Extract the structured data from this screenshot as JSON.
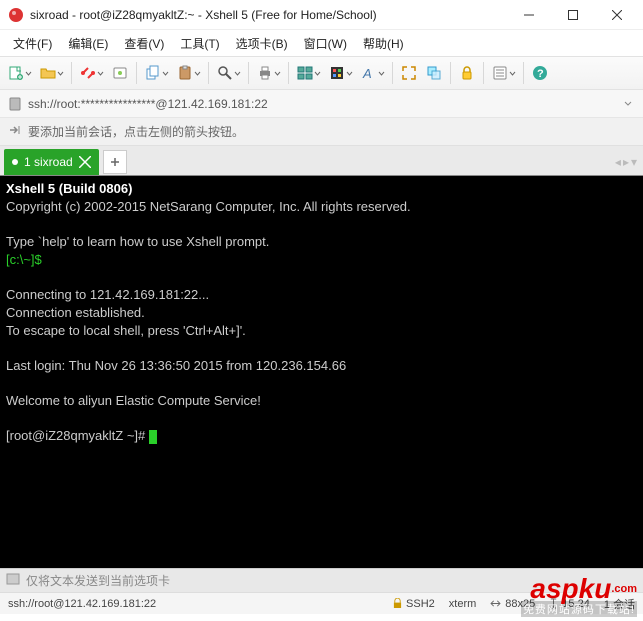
{
  "titlebar": {
    "title": "sixroad - root@iZ28qmyakltZ:~ - Xshell 5 (Free for Home/School)"
  },
  "menu": {
    "file": "文件(F)",
    "edit": "编辑(E)",
    "view": "查看(V)",
    "tools": "工具(T)",
    "tabs": "选项卡(B)",
    "window": "窗口(W)",
    "help": "帮助(H)"
  },
  "addressbar": {
    "text": "ssh://root:****************@121.42.169.181:22"
  },
  "hintbar": {
    "text": "要添加当前会话，点击左侧的箭头按钮。"
  },
  "tab": {
    "label": "1 sixroad"
  },
  "terminal": {
    "l1": "Xshell 5 (Build 0806)",
    "l2": "Copyright (c) 2002-2015 NetSarang Computer, Inc. All rights reserved.",
    "l3": "Type `help' to learn how to use Xshell prompt.",
    "l4": "[c:\\~]$",
    "l5": "Connecting to 121.42.169.181:22...",
    "l6": "Connection established.",
    "l7": "To escape to local shell, press 'Ctrl+Alt+]'.",
    "l8": "Last login: Thu Nov 26 13:36:50 2015 from 120.236.154.66",
    "l9": "Welcome to aliyun Elastic Compute Service!",
    "l10": "[root@iZ28qmyakltZ ~]# "
  },
  "sendbar": {
    "text": "仅将文本发送到当前选项卡"
  },
  "status": {
    "conn": "ssh://root@121.42.169.181:22",
    "proto": "SSH2",
    "term": "xterm",
    "size": "88x25",
    "pos": "15,24",
    "sess": "1 会话"
  },
  "watermark": {
    "l1a": "aspku",
    "l1b": ".com",
    "l2": "免费网站源码下载站!"
  }
}
